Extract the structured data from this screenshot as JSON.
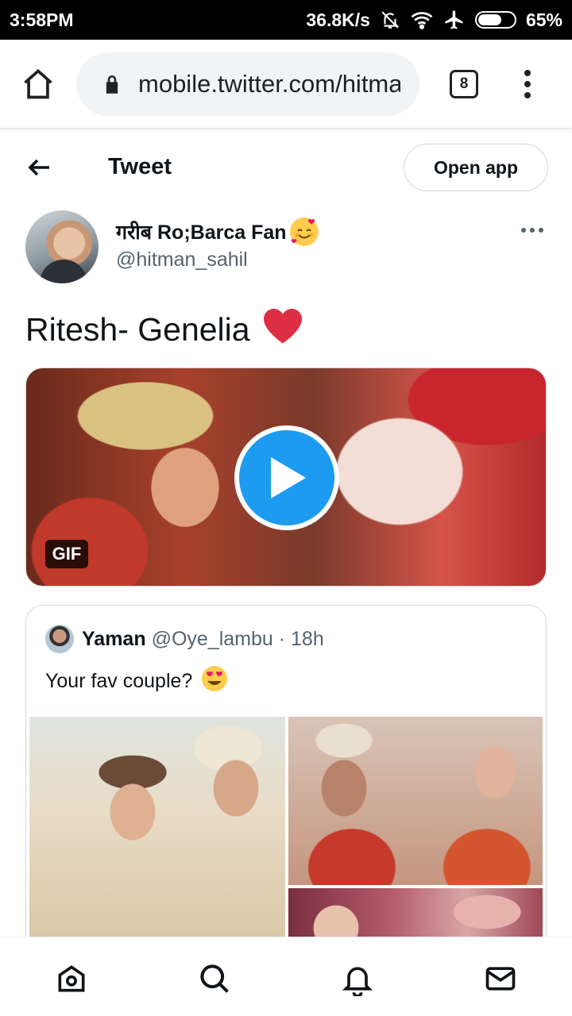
{
  "status_bar": {
    "time": "3:58PM",
    "net_speed": "36.8K/s",
    "battery": "65%",
    "battery_level": 0.65,
    "icons": [
      "bell-off-icon",
      "wifi-icon",
      "airplane-icon",
      "battery-icon"
    ]
  },
  "browser": {
    "url": "mobile.twitter.com/hitman_sahil",
    "tab_count": "8",
    "icons": [
      "home-icon",
      "lock-icon",
      "tabs-icon",
      "more-vert-icon"
    ]
  },
  "header": {
    "title": "Tweet",
    "open_app_label": "Open app"
  },
  "tweet": {
    "author_name": "गरीब Ro;Barca Fan",
    "author_handle": "@hitman_sahil",
    "text": "Ritesh- Genelia",
    "media_badge": "GIF"
  },
  "quoted_tweet": {
    "name": "Yaman",
    "handle": "@Oye_lambu",
    "separator": "·",
    "time": "18h",
    "text": "Your fav couple?"
  },
  "bottom_nav": [
    "home-icon",
    "search-icon",
    "notifications-icon",
    "messages-icon"
  ],
  "colors": {
    "accent": "#1d9bf0",
    "text": "#0f1419",
    "secondary": "#536471",
    "heart": "#e0245e"
  }
}
